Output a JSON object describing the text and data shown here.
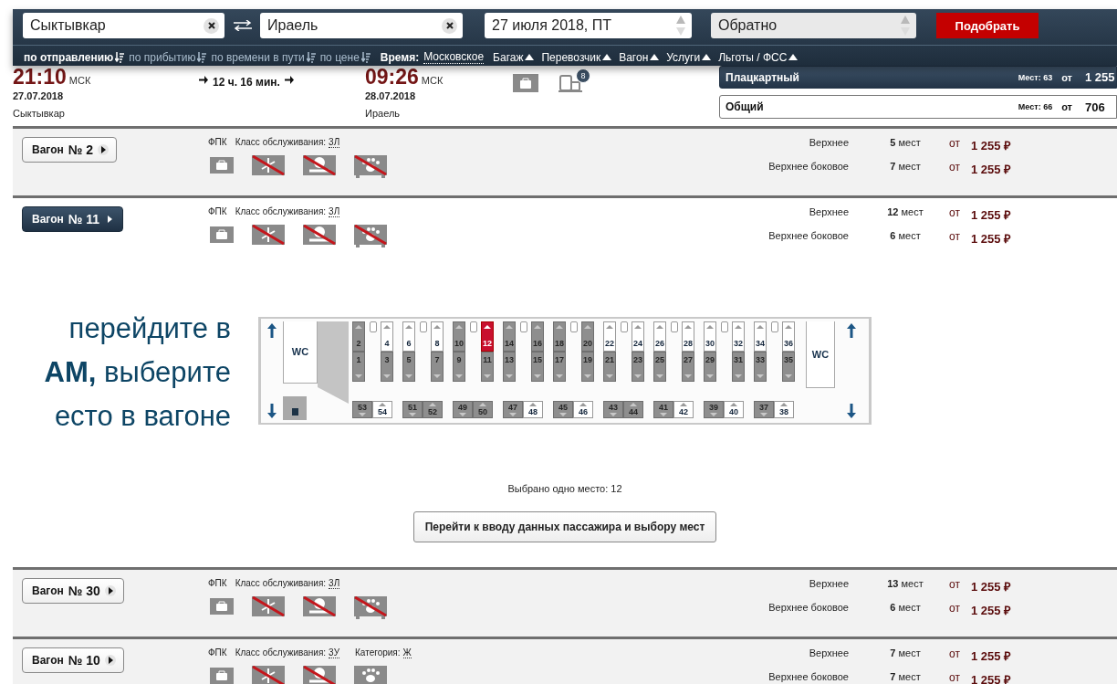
{
  "search": {
    "from": {
      "value": "Сыктывкар"
    },
    "to": {
      "value": "Ираель"
    },
    "date": {
      "value": "27 июля 2018, ПТ"
    },
    "return": {
      "value": "Обратно"
    },
    "submit": "Подобрать"
  },
  "sort_options": [
    {
      "label": "по отправлению",
      "selected": true
    },
    {
      "label": "по прибытию",
      "selected": false
    },
    {
      "label": "по времени в пути",
      "selected": false
    },
    {
      "label": "по цене",
      "selected": false
    }
  ],
  "time_label": "Время:",
  "time_value": "Московское",
  "filters": [
    "Багаж",
    "Перевозчик",
    "Вагон",
    "Услуги",
    "Льготы / ФСС"
  ],
  "train": {
    "departure": {
      "time": "21:10",
      "zone": "МСК",
      "date": "27.07.2018",
      "station": "Сыктывкар"
    },
    "duration": "12 ч. 16 мин.",
    "arrival": {
      "time": "09:26",
      "zone": "МСК",
      "date": "28.07.2018",
      "station": "Ираель"
    },
    "luggage_badge": "8",
    "car_types": [
      {
        "name": "Плацкартный",
        "selected": true,
        "seats": "Мест: 63",
        "from": "от",
        "price": "1 255"
      },
      {
        "name": "Общий",
        "selected": false,
        "seats": "Мест: 66",
        "from": "от",
        "price": "706"
      }
    ]
  },
  "wagons": [
    {
      "label": "Вагон",
      "number": "№ 2",
      "expanded": false,
      "carrier": "ФПК",
      "class_label": "Класс обслуживания:",
      "class_value": "3Л",
      "amenities": [
        {
          "kind": "baggage",
          "available": true
        },
        {
          "kind": "climate",
          "available": false
        },
        {
          "kind": "wc",
          "available": false
        },
        {
          "kind": "pets",
          "available": false
        }
      ],
      "berths": [
        {
          "type": "Верхнее",
          "count": "**5** мест",
          "from": "от",
          "price": "1 255 ₽"
        },
        {
          "type": "Верхнее боковое",
          "count": "**7** мест",
          "from": "от",
          "price": "1 255 ₽"
        }
      ]
    },
    {
      "label": "Вагон",
      "number": "№ 11",
      "expanded": true,
      "carrier": "ФПК",
      "class_label": "Класс обслуживания:",
      "class_value": "3Л",
      "amenities": [
        {
          "kind": "baggage",
          "available": true
        },
        {
          "kind": "climate",
          "available": false
        },
        {
          "kind": "wc",
          "available": false
        },
        {
          "kind": "pets",
          "available": false
        }
      ],
      "berths": [
        {
          "type": "Верхнее",
          "count": "**12** мест",
          "from": "от",
          "price": "1 255 ₽"
        },
        {
          "type": "Верхнее боковое",
          "count": "**6** мест",
          "from": "от",
          "price": "1 255 ₽"
        }
      ],
      "seat_map": {
        "wc_labels": [
          "WC",
          "WC"
        ],
        "compartments": [
          {
            "berths": [
              {
                "number": "2",
                "available": false,
                "selected": false
              },
              {
                "number": "1",
                "available": false,
                "selected": false
              },
              {
                "number": "4",
                "available": true,
                "selected": false
              },
              {
                "number": "3",
                "available": false,
                "selected": false
              }
            ]
          },
          {
            "berths": [
              {
                "number": "6",
                "available": true,
                "selected": false
              },
              {
                "number": "5",
                "available": false,
                "selected": false
              },
              {
                "number": "8",
                "available": true,
                "selected": false
              },
              {
                "number": "7",
                "available": false,
                "selected": false
              }
            ]
          },
          {
            "berths": [
              {
                "number": "10",
                "available": false,
                "selected": false
              },
              {
                "number": "9",
                "available": false,
                "selected": false
              },
              {
                "number": "12",
                "available": true,
                "selected": true
              },
              {
                "number": "11",
                "available": false,
                "selected": false
              }
            ]
          },
          {
            "berths": [
              {
                "number": "14",
                "available": false,
                "selected": false
              },
              {
                "number": "13",
                "available": false,
                "selected": false
              },
              {
                "number": "16",
                "available": false,
                "selected": false
              },
              {
                "number": "15",
                "available": false,
                "selected": false
              }
            ]
          },
          {
            "berths": [
              {
                "number": "18",
                "available": false,
                "selected": false
              },
              {
                "number": "17",
                "available": false,
                "selected": false
              },
              {
                "number": "20",
                "available": false,
                "selected": false
              },
              {
                "number": "19",
                "available": false,
                "selected": false
              }
            ]
          },
          {
            "berths": [
              {
                "number": "22",
                "available": true,
                "selected": false
              },
              {
                "number": "21",
                "available": false,
                "selected": false
              },
              {
                "number": "24",
                "available": true,
                "selected": false
              },
              {
                "number": "23",
                "available": false,
                "selected": false
              }
            ]
          },
          {
            "berths": [
              {
                "number": "26",
                "available": true,
                "selected": false
              },
              {
                "number": "25",
                "available": false,
                "selected": false
              },
              {
                "number": "28",
                "available": true,
                "selected": false
              },
              {
                "number": "27",
                "available": false,
                "selected": false
              }
            ]
          },
          {
            "berths": [
              {
                "number": "30",
                "available": true,
                "selected": false
              },
              {
                "number": "29",
                "available": false,
                "selected": false
              },
              {
                "number": "32",
                "available": true,
                "selected": false
              },
              {
                "number": "31",
                "available": false,
                "selected": false
              }
            ]
          },
          {
            "berths": [
              {
                "number": "34",
                "available": true,
                "selected": false
              },
              {
                "number": "33",
                "available": false,
                "selected": false
              },
              {
                "number": "36",
                "available": true,
                "selected": false
              },
              {
                "number": "35",
                "available": false,
                "selected": false
              }
            ]
          }
        ],
        "side_pairs": [
          {
            "berths": [
              {
                "number": "53",
                "available": false,
                "selected": false
              },
              {
                "number": "54",
                "available": true,
                "selected": false
              }
            ]
          },
          {
            "berths": [
              {
                "number": "51",
                "available": false,
                "selected": false
              },
              {
                "number": "52",
                "available": false,
                "selected": false
              }
            ]
          },
          {
            "berths": [
              {
                "number": "49",
                "available": false,
                "selected": false
              },
              {
                "number": "50",
                "available": false,
                "selected": false
              }
            ]
          },
          {
            "berths": [
              {
                "number": "47",
                "available": false,
                "selected": false
              },
              {
                "number": "48",
                "available": true,
                "selected": false
              }
            ]
          },
          {
            "berths": [
              {
                "number": "45",
                "available": false,
                "selected": false
              },
              {
                "number": "46",
                "available": true,
                "selected": false
              }
            ]
          },
          {
            "berths": [
              {
                "number": "43",
                "available": false,
                "selected": false
              },
              {
                "number": "44",
                "available": false,
                "selected": false
              }
            ]
          },
          {
            "berths": [
              {
                "number": "41",
                "available": false,
                "selected": false
              },
              {
                "number": "42",
                "available": true,
                "selected": false
              }
            ]
          },
          {
            "berths": [
              {
                "number": "39",
                "available": false,
                "selected": false
              },
              {
                "number": "40",
                "available": true,
                "selected": false
              }
            ]
          },
          {
            "berths": [
              {
                "number": "37",
                "available": false,
                "selected": false
              },
              {
                "number": "38",
                "available": true,
                "selected": false
              }
            ]
          }
        ]
      },
      "selection_note": "Выбрано одно место: 12",
      "continue_button": "Перейти к вводу данных пассажира и выбору мест"
    },
    {
      "label": "Вагон",
      "number": "№ 30",
      "expanded": false,
      "carrier": "ФПК",
      "class_label": "Класс обслуживания:",
      "class_value": "3Л",
      "amenities": [
        {
          "kind": "baggage",
          "available": true
        },
        {
          "kind": "climate",
          "available": false
        },
        {
          "kind": "wc",
          "available": false
        },
        {
          "kind": "pets",
          "available": false
        }
      ],
      "berths": [
        {
          "type": "Верхнее",
          "count": "**13** мест",
          "from": "от",
          "price": "1 255 ₽"
        },
        {
          "type": "Верхнее боковое",
          "count": "**6** мест",
          "from": "от",
          "price": "1 255 ₽"
        }
      ]
    },
    {
      "label": "Вагон",
      "number": "№ 10",
      "expanded": false,
      "carrier": "ФПК",
      "class_label": "Класс обслуживания:",
      "class_value": "3У",
      "category_label": "Категория:",
      "category_value": "Ж",
      "amenities": [
        {
          "kind": "baggage",
          "available": true
        },
        {
          "kind": "climate",
          "available": false
        },
        {
          "kind": "wc",
          "available": false
        },
        {
          "kind": "pets",
          "available": true
        }
      ],
      "berths": [
        {
          "type": "Верхнее",
          "count": "**7** мест",
          "from": "от",
          "price": "1 255 ₽"
        },
        {
          "type": "Верхнее боковое",
          "count": "**7** мест",
          "from": "от",
          "price": "1 255 ₽"
        }
      ]
    }
  ],
  "caption": {
    "lines": [
      "перейдите в",
      "**АМ,** выберите",
      "есто в вагоне"
    ]
  }
}
